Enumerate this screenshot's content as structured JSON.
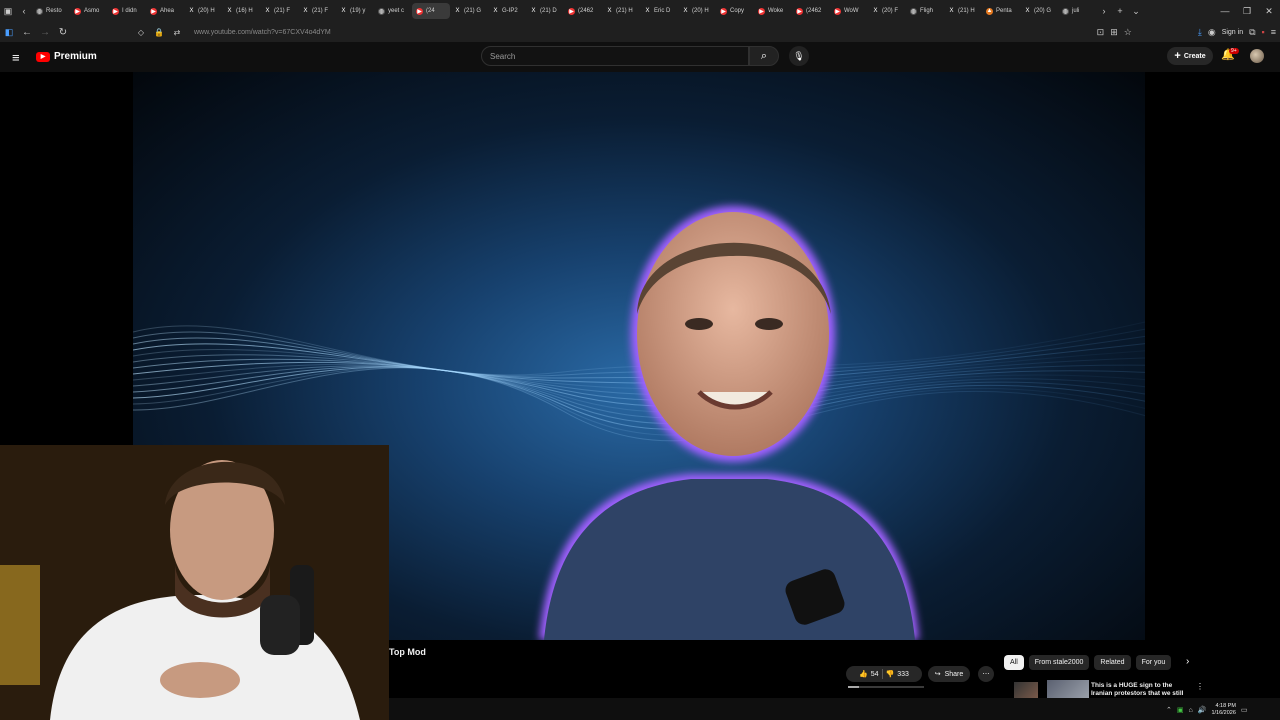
{
  "browser": {
    "tabs": [
      {
        "label": "Resto",
        "icon": "globe-icon"
      },
      {
        "label": "Asmo",
        "icon": "youtube-icon"
      },
      {
        "label": "I didn",
        "icon": "youtube-icon"
      },
      {
        "label": "Ahea",
        "icon": "youtube-icon"
      },
      {
        "label": "(20) H",
        "icon": "x-icon"
      },
      {
        "label": "(16) H",
        "icon": "x-icon"
      },
      {
        "label": "(21) F",
        "icon": "x-icon"
      },
      {
        "label": "(21) F",
        "icon": "x-icon"
      },
      {
        "label": "(19) y",
        "icon": "x-icon"
      },
      {
        "label": "yeet c",
        "icon": "globe-icon"
      },
      {
        "label": "(24",
        "icon": "youtube-icon",
        "active": true
      },
      {
        "label": "(21) G",
        "icon": "x-icon"
      },
      {
        "label": "G-IP2",
        "icon": "x-icon"
      },
      {
        "label": "(21) D",
        "icon": "x-icon"
      },
      {
        "label": "(2462",
        "icon": "youtube-icon"
      },
      {
        "label": "(21) H",
        "icon": "x-icon"
      },
      {
        "label": "Eric D",
        "icon": "x-icon"
      },
      {
        "label": "(20) H",
        "icon": "x-icon"
      },
      {
        "label": "Copy",
        "icon": "youtube-icon"
      },
      {
        "label": "Woke",
        "icon": "youtube-icon"
      },
      {
        "label": "(2462",
        "icon": "youtube-icon"
      },
      {
        "label": "WoW",
        "icon": "youtube-icon"
      },
      {
        "label": "(20) F",
        "icon": "x-icon"
      },
      {
        "label": "Fligh",
        "icon": "globe-icon"
      },
      {
        "label": "(21) H",
        "icon": "x-icon"
      },
      {
        "label": "Penta",
        "icon": "shield-icon"
      },
      {
        "label": "(20) G",
        "icon": "x-icon"
      },
      {
        "label": "juli",
        "icon": "globe-icon"
      }
    ],
    "url": "www.youtube.com/watch?v=67CXV4o4dYM",
    "sign_in": "Sign in"
  },
  "youtube": {
    "logo_text": "Premium",
    "search_placeholder": "Search",
    "create_label": "Create",
    "notif_count": "9+",
    "video_title": "Top Mod",
    "likes": "54",
    "dislikes": "333",
    "share_label": "Share",
    "chips": [
      "All",
      "From stale2000",
      "Related",
      "For you"
    ],
    "rec_title": "This is a HUGE sign to the Iranian protestors that we still"
  },
  "system": {
    "time": "4:18 PM",
    "date": "1/16/2026"
  },
  "colors": {
    "brand": "#ff0000",
    "bg": "#0f0f0f",
    "glow": "#a050ff"
  }
}
